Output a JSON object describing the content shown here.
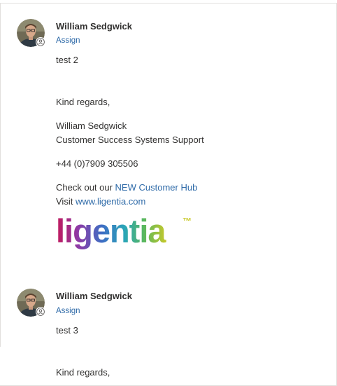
{
  "messages": [
    {
      "sender": "William Sedgwick",
      "assign_label": "Assign",
      "body": "test 2",
      "closing": "Kind regards,",
      "signature_name": "William Sedgwick",
      "signature_title": "Customer Success Systems Support",
      "phone": "+44 (0)7909 305506",
      "hub_prefix": "Check out our ",
      "hub_link": "NEW Customer Hub",
      "visit_prefix": "Visit ",
      "visit_link": "www.ligentia.com",
      "logo": {
        "text": "ligentia",
        "trademark": "™",
        "colors": [
          "#c2185b",
          "#7b3fa0",
          "#3d6fc4",
          "#2aa6b8",
          "#5cb85c",
          "#c9c92a"
        ]
      }
    },
    {
      "sender": "William Sedgwick",
      "assign_label": "Assign",
      "body": "test 3",
      "closing": "Kind regards,"
    }
  ],
  "colors": {
    "link": "#2e6aa8",
    "text": "#323130",
    "border": "#e1dfdd"
  },
  "icons": {
    "presence": "person-status-icon"
  }
}
